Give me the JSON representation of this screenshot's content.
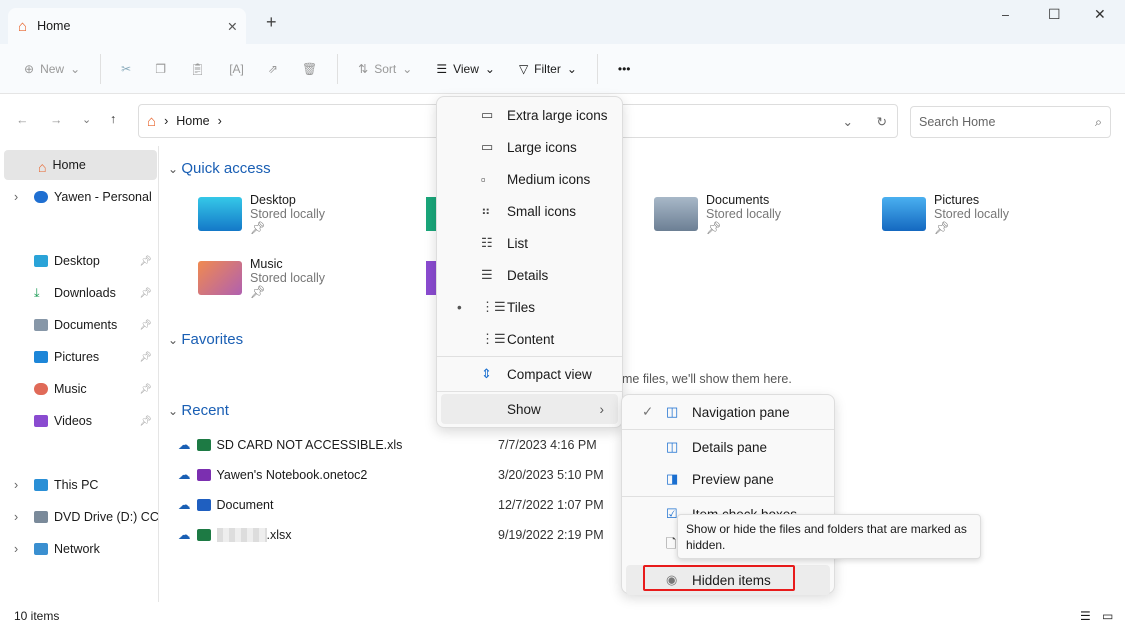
{
  "window": {
    "tab_title": "Home",
    "new_tab": "+",
    "controls": [
      "–",
      "☐",
      "✕"
    ]
  },
  "toolbar": {
    "new": "New",
    "sort": "Sort",
    "view": "View",
    "filter": "Filter",
    "more": "•••"
  },
  "address": {
    "crumb": "Home",
    "search_placeholder": "Search Home"
  },
  "nav": {
    "items": [
      {
        "label": "Home",
        "selected": true
      },
      {
        "label": "Yawen - Personal"
      },
      {
        "label": "Desktop",
        "pinned": true
      },
      {
        "label": "Downloads",
        "pinned": true
      },
      {
        "label": "Documents",
        "pinned": true
      },
      {
        "label": "Pictures",
        "pinned": true
      },
      {
        "label": "Music",
        "pinned": true
      },
      {
        "label": "Videos",
        "pinned": true
      },
      {
        "label": "This PC"
      },
      {
        "label": "DVD Drive (D:) CCC"
      },
      {
        "label": "Network"
      }
    ]
  },
  "main": {
    "quick_access": "Quick access",
    "favorites": "Favorites",
    "recent": "Recent",
    "favorites_empty": "me files, we'll show them here.",
    "folders": [
      {
        "name": "Desktop",
        "sub": "Stored locally"
      },
      {
        "name": "Documents",
        "sub": "Stored locally"
      },
      {
        "name": "Pictures",
        "sub": "Stored locally"
      },
      {
        "name": "Music",
        "sub": "Stored locally"
      }
    ],
    "recent_files": [
      {
        "name": "SD CARD NOT ACCESSIBLE.xls",
        "date": "7/7/2023 4:16 PM",
        "app": "excel"
      },
      {
        "name": "Yawen's Notebook.onetoc2",
        "date": "3/20/2023 5:10 PM",
        "app": "onenote"
      },
      {
        "name": "Document",
        "date": "12/7/2022 1:07 PM",
        "app": "word"
      },
      {
        "name": ".xlsx",
        "date": "9/19/2022 2:19 PM",
        "app": "excel"
      }
    ]
  },
  "view_menu": {
    "items": [
      "Extra large icons",
      "Large icons",
      "Medium icons",
      "Small icons",
      "List",
      "Details",
      "Tiles",
      "Content"
    ],
    "selected": "Tiles",
    "compact": "Compact view",
    "show": "Show"
  },
  "show_menu": {
    "navigation_pane": "Navigation pane",
    "details_pane": "Details pane",
    "preview_pane": "Preview pane",
    "item_check_boxes": "Item check boxes",
    "hidden_items": "Hidden items"
  },
  "tooltip": "Show or hide the files and folders that are marked as hidden.",
  "status": {
    "count": "10 items"
  },
  "colors": {
    "accent": "#1a5fb4",
    "highlight": "#e81b1b"
  }
}
